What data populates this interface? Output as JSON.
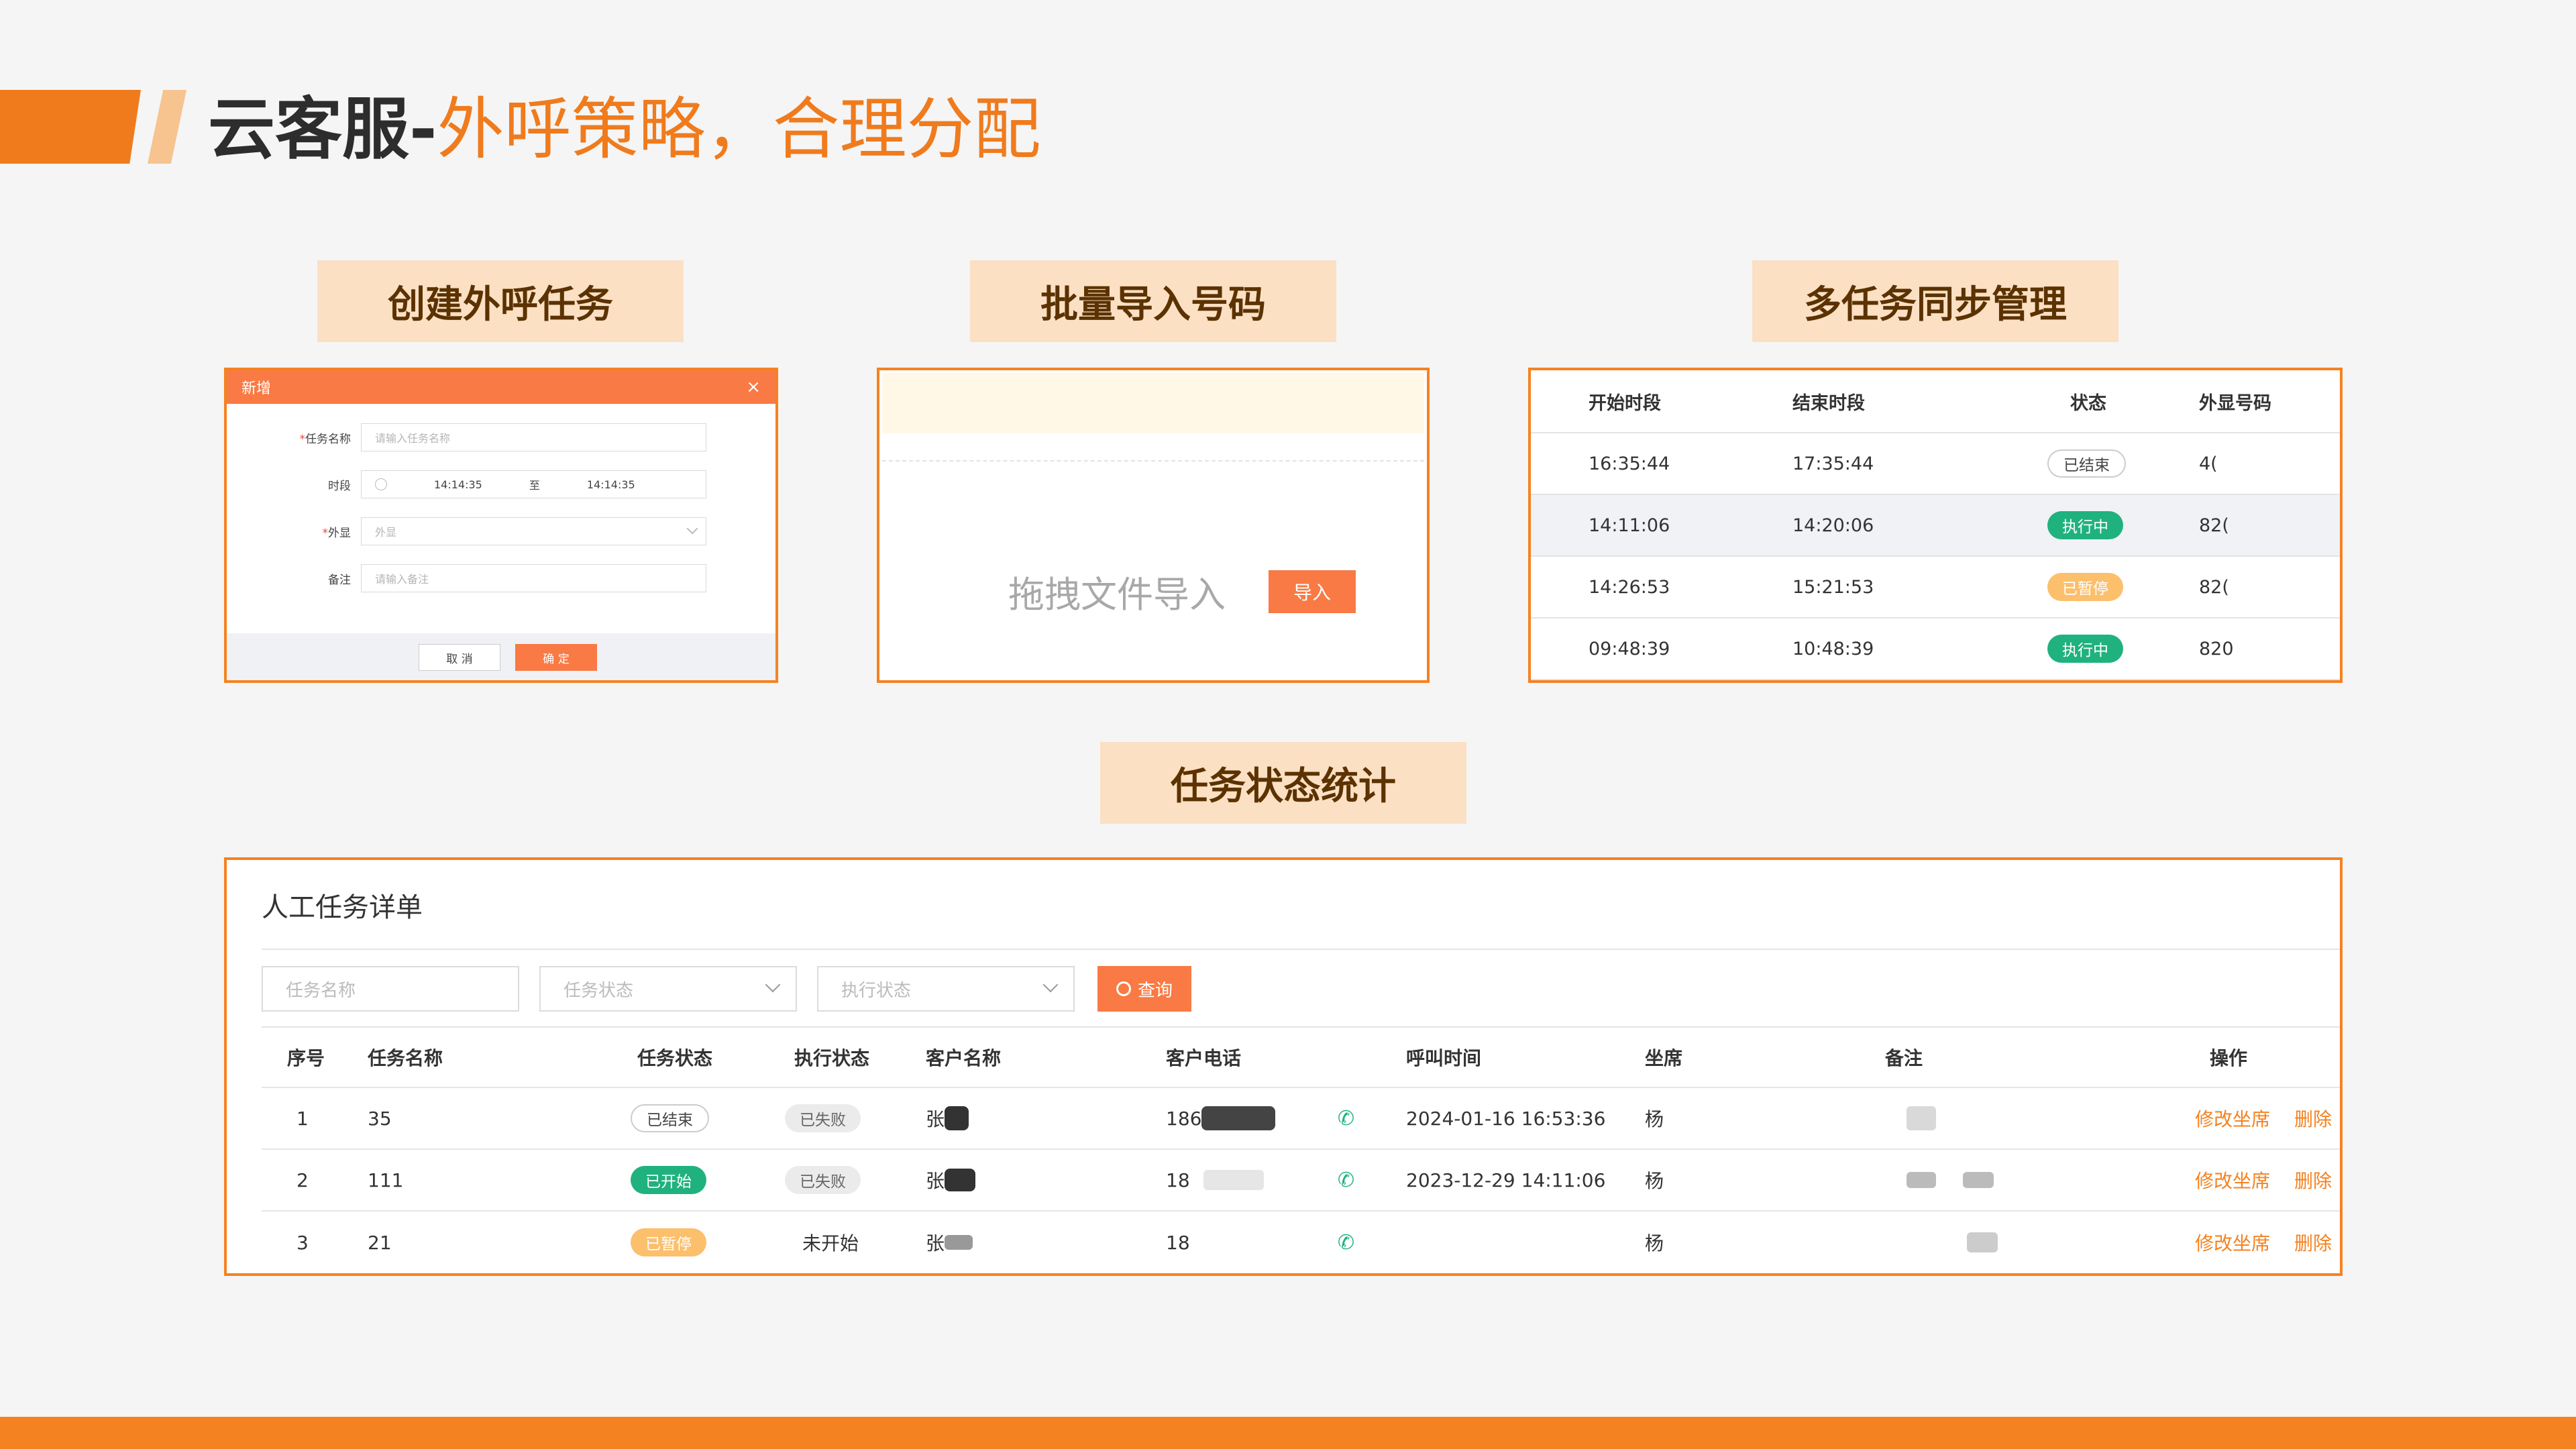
{
  "header": {
    "title_dark": "云客服-",
    "title_orange": "外呼策略，合理分配"
  },
  "sections": {
    "create": "创建外呼任务",
    "import": "批量导入号码",
    "multi": "多任务同步管理",
    "stats": "任务状态统计"
  },
  "dialog": {
    "title": "新增",
    "close": "×",
    "fields": [
      {
        "label": "任务名称",
        "required": true,
        "placeholder": "请输入任务名称"
      },
      {
        "label": "时段",
        "required": false,
        "start": "14:14:35",
        "sep": "至",
        "end": "14:14:35"
      },
      {
        "label": "外显",
        "required": true,
        "placeholder": "外显"
      },
      {
        "label": "备注",
        "required": false,
        "placeholder": "请输入备注"
      }
    ],
    "required_mark": "*",
    "cancel": "取 消",
    "confirm": "确 定"
  },
  "import_panel": {
    "drop_text": "拖拽文件导入",
    "import_button": "导入"
  },
  "multi_table": {
    "headers": [
      "开始时段",
      "结束时段",
      "状态",
      "外显号码"
    ],
    "rows": [
      {
        "start": "16:35:44",
        "end": "17:35:44",
        "status": "已结束",
        "status_type": "ended",
        "number": "4("
      },
      {
        "start": "14:11:06",
        "end": "14:20:06",
        "status": "执行中",
        "status_type": "run",
        "number": "82("
      },
      {
        "start": "14:26:53",
        "end": "15:21:53",
        "status": "已暂停",
        "status_type": "pause",
        "number": "82("
      },
      {
        "start": "09:48:39",
        "end": "10:48:39",
        "status": "执行中",
        "status_type": "run",
        "number": "820"
      }
    ]
  },
  "detail": {
    "title": "人工任务详单",
    "filters": {
      "name": "任务名称",
      "task_status": "任务状态",
      "exec_status": "执行状态",
      "query": "查询"
    },
    "headers": [
      "序号",
      "任务名称",
      "任务状态",
      "执行状态",
      "客户名称",
      "客户电话",
      "呼叫时间",
      "坐席",
      "备注",
      "操作"
    ],
    "rows": [
      {
        "no": "1",
        "name": "35",
        "task_status": "已结束",
        "task_type": "ended",
        "exec_status": "已失败",
        "exec_type": "fail",
        "customer": "张",
        "phone": "186",
        "call_time": "2024-01-16 16:53:36",
        "agent": "杨",
        "edit": "修改坐席",
        "delete": "删除"
      },
      {
        "no": "2",
        "name": "111",
        "task_status": "已开始",
        "task_type": "run",
        "exec_status": "已失败",
        "exec_type": "fail",
        "customer": "张",
        "phone": "18",
        "call_time": "2023-12-29 14:11:06",
        "agent": "杨",
        "edit": "修改坐席",
        "delete": "删除"
      },
      {
        "no": "3",
        "name": "21",
        "task_status": "已暂停",
        "task_type": "pause",
        "exec_status": "未开始",
        "exec_type": "plain",
        "customer": "张",
        "phone": "18",
        "call_time": "",
        "agent": "杨",
        "edit": "修改坐席",
        "delete": "删除"
      }
    ]
  },
  "colors": {
    "accent": "#f58220",
    "run": "#20b27e",
    "pause": "#fcbf6c",
    "label_bg": "#fbe0c4"
  }
}
